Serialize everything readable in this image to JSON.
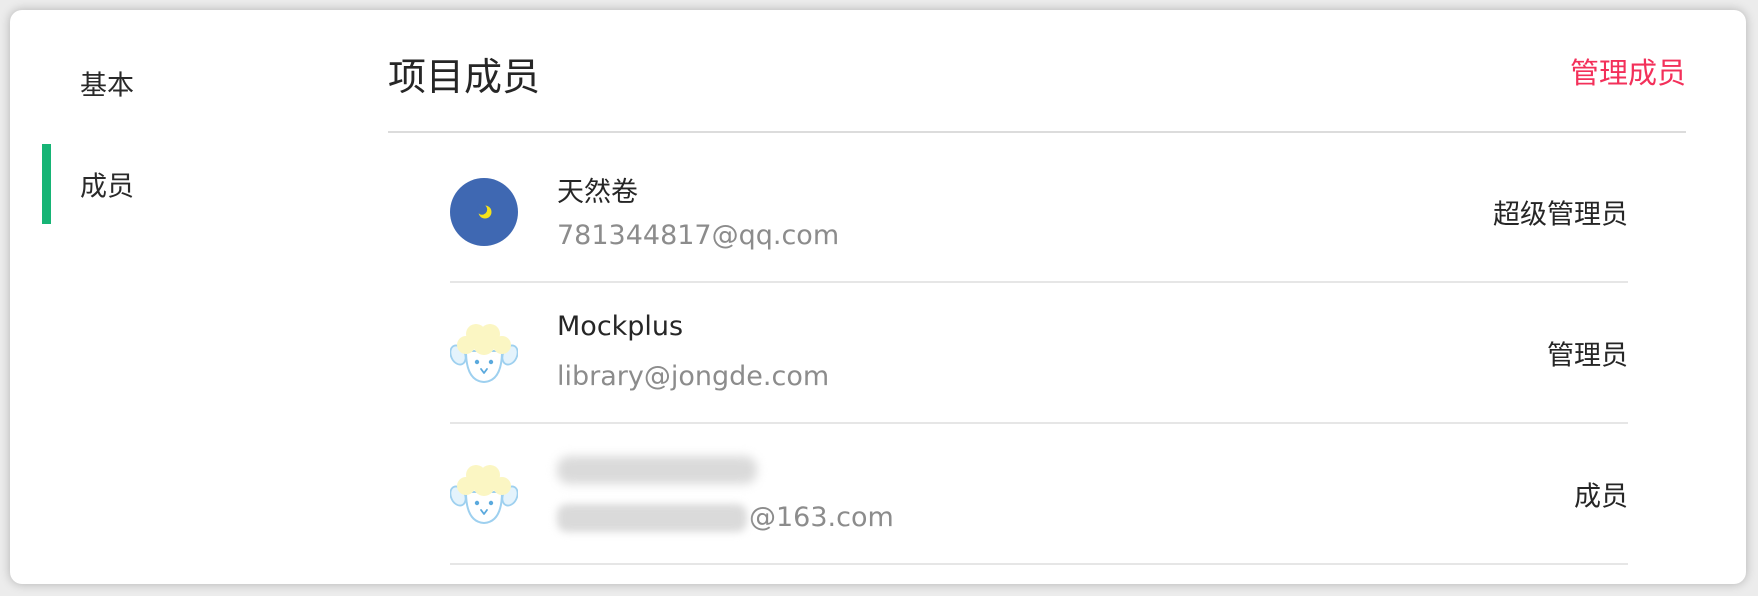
{
  "sidebar": {
    "items": [
      {
        "label": "基本",
        "active": false
      },
      {
        "label": "成员",
        "active": true
      }
    ],
    "active_color": "#16b475"
  },
  "header": {
    "title": "项目成员",
    "manage_label": "管理成员",
    "manage_color": "#f3305a"
  },
  "members": [
    {
      "name": "天然卷",
      "email": "781344817@qq.com",
      "role": "超级管理员",
      "avatar": "moon-avatar-icon"
    },
    {
      "name": "Mockplus",
      "email": "library@jongde.com",
      "role": "管理员",
      "avatar": "sheep-avatar-icon"
    },
    {
      "name": "",
      "email_suffix": "@163.com",
      "role": "成员",
      "avatar": "sheep-avatar-icon"
    }
  ]
}
